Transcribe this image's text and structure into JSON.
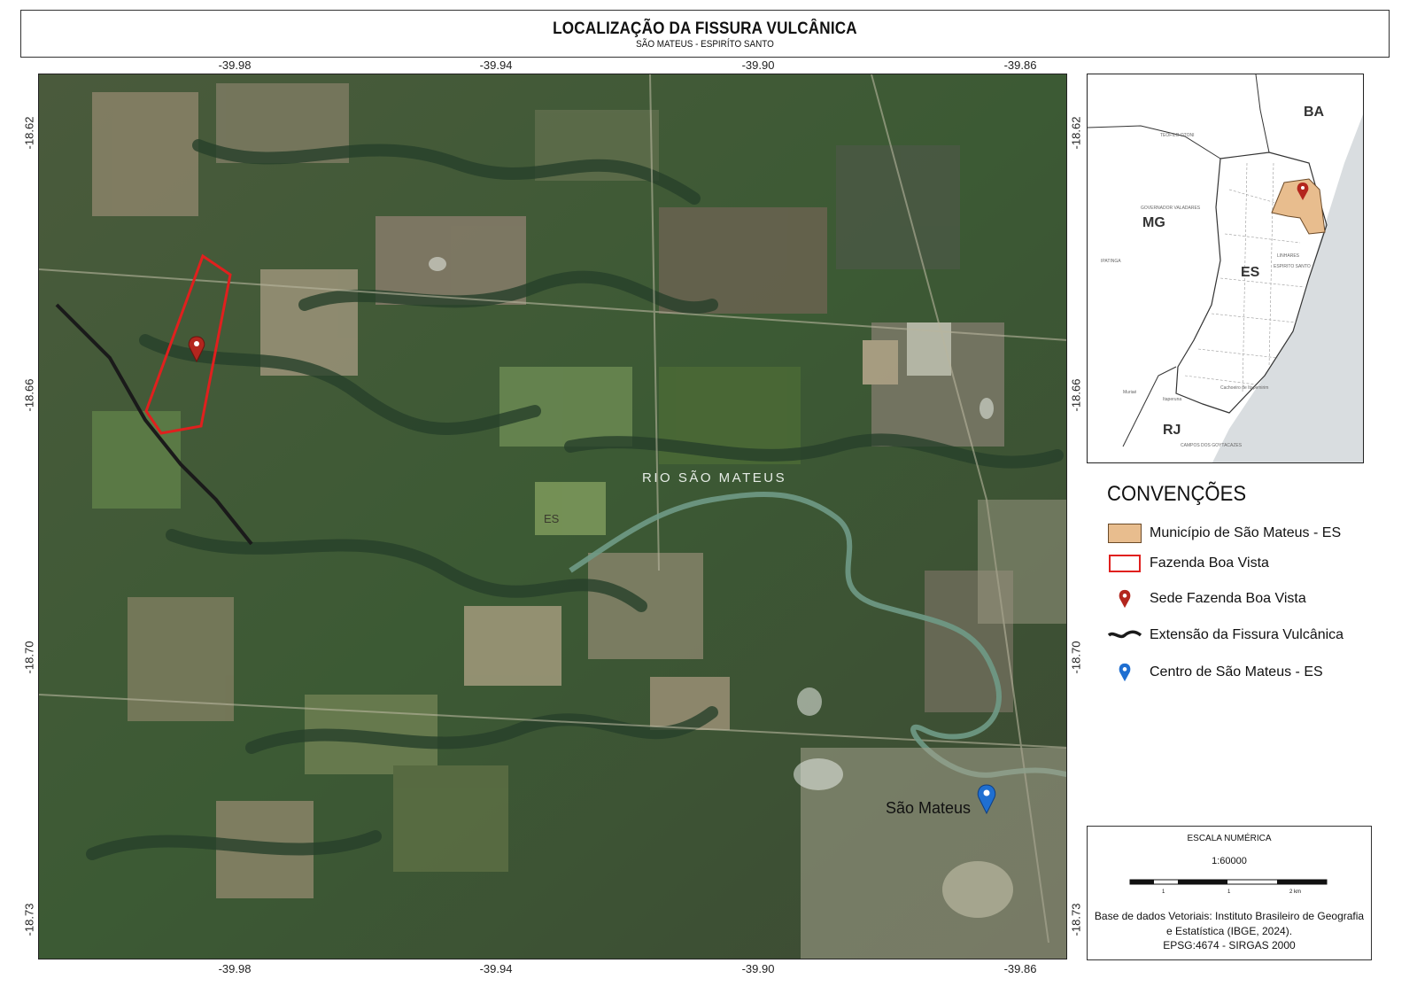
{
  "header": {
    "title": "LOCALIZAÇÃO DA FISSURA VULCÂNICA",
    "subtitle": "SÃO MATEUS - ESPIRÍTO SANTO"
  },
  "axes": {
    "longitudes": [
      "-39.98",
      "-39.94",
      "-39.90",
      "-39.86"
    ],
    "latitudes": [
      "-18.62",
      "-18.66",
      "-18.70",
      "-18.73"
    ]
  },
  "map": {
    "river_label": "RIO SÃO MATEUS",
    "state_label": "ES",
    "city_label": "São Mateus",
    "colors": {
      "farm_outline": "#e0201e",
      "fissure": "#1a1a1a",
      "farm_pin": "#b3261e",
      "city_pin": "#1f6fd1",
      "river": "#6f9a86"
    }
  },
  "inset": {
    "labels": {
      "ba": "BA",
      "mg": "MG",
      "es": "ES",
      "rj": "RJ",
      "teofilo": "TEÓFILO OTONI",
      "governador": "GOVERNADOR VALADARES",
      "ipatinga": "IPATINGA",
      "linhares": "LINHARES",
      "espirito": "ESPIRITO SANTO",
      "muriae": "Muriaé",
      "itaperuna": "Itaperuna",
      "campos": "CAMPOS DOS GOYTACAZES",
      "cachoeiro": "Cachoeiro de Itapemirim"
    },
    "colors": {
      "ocean": "#d9dde0",
      "municipality": "#e8bd8e",
      "land": "#ffffff"
    }
  },
  "legend": {
    "title": "CONVENÇÕES",
    "items": [
      {
        "label": "Município de São Mateus - ES",
        "symbol": "municipality-fill",
        "color": "#e8bd8e"
      },
      {
        "label": "Fazenda Boa Vista",
        "symbol": "farm-outline",
        "color": "#e0201e"
      },
      {
        "label": "Sede Fazenda Boa Vista",
        "symbol": "red-pin-icon",
        "color": "#b3261e"
      },
      {
        "label": "Extensão da Fissura Vulcânica",
        "symbol": "wavy-line",
        "color": "#1a1a1a"
      },
      {
        "label": "Centro de São Mateus - ES",
        "symbol": "blue-pin-icon",
        "color": "#1f6fd1"
      }
    ]
  },
  "scale": {
    "title": "ESCALA NUMÉRICA",
    "ratio": "1:60000",
    "ticks": [
      "1",
      "1",
      "2 km"
    ],
    "source_line1": "Base de dados Vetoriais: Instituto Brasileiro de Geografia",
    "source_line2": "e Estatística (IBGE, 2024).",
    "source_line3": "EPSG:4674 - SIRGAS 2000"
  }
}
